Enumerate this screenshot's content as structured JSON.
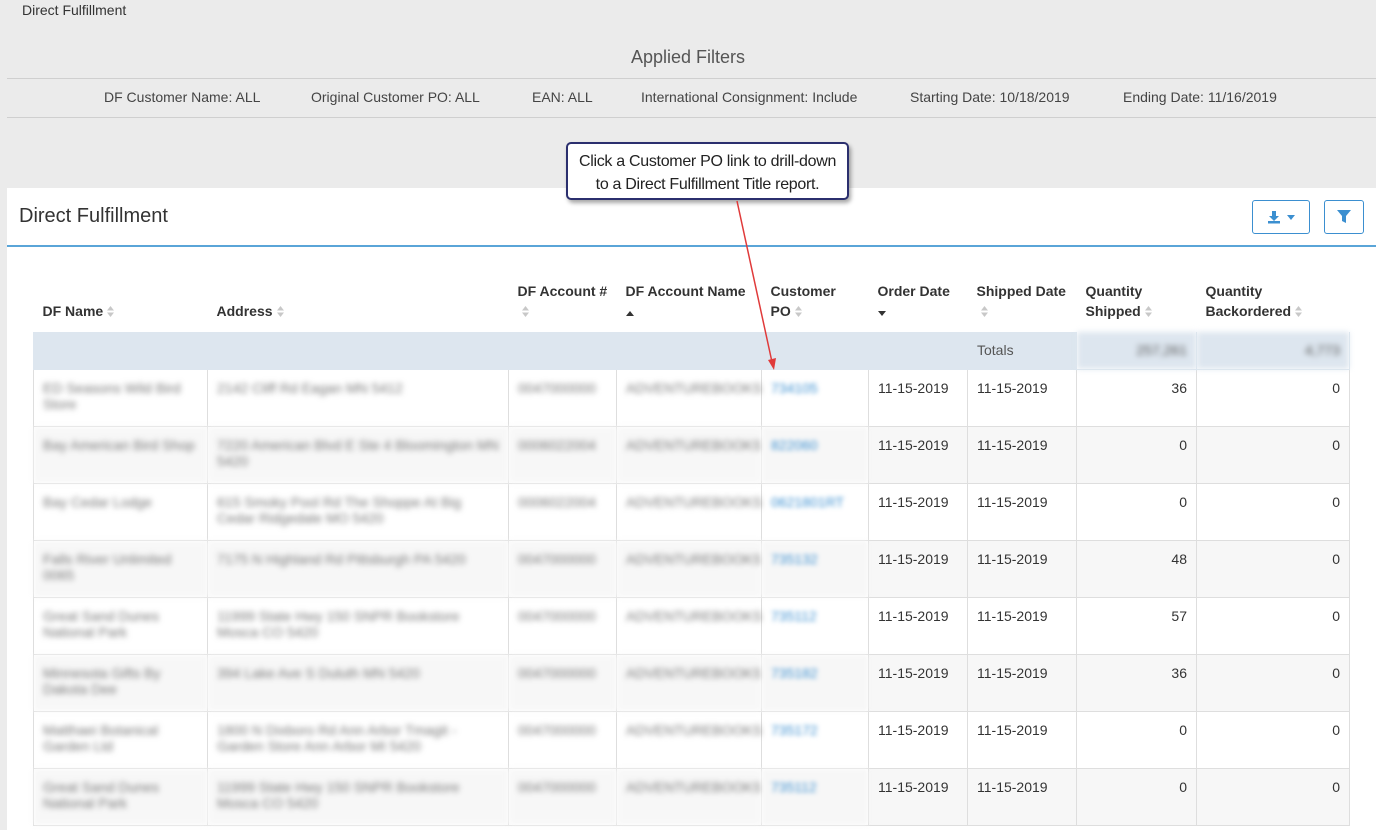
{
  "breadcrumb": "Direct Fulfillment",
  "filters": {
    "title": "Applied Filters",
    "items": [
      "DF Customer Name: ALL",
      "Original Customer PO: ALL",
      "EAN: ALL",
      "International Consignment: Include",
      "Starting Date: 10/18/2019",
      "Ending Date: 11/16/2019"
    ]
  },
  "callout": {
    "line1": "Click a Customer PO link to drill-down",
    "line2": "to a Direct Fulfillment Title report."
  },
  "panel": {
    "title": "Direct Fulfillment",
    "export_icon": "download-icon",
    "caret_icon": "caret-down-icon",
    "filter_icon": "filter-icon"
  },
  "table": {
    "columns": [
      "DF Name",
      "Address",
      "DF Account #",
      "DF Account Name",
      "Customer PO",
      "Order Date",
      "Shipped Date",
      "Quantity Shipped",
      "Quantity Backordered"
    ],
    "totals_label": "Totals",
    "totals_shipped": "257,261",
    "totals_backordered": "4,773",
    "rows": [
      {
        "name": "ED Seasons Wild Bird Store",
        "address": "2142 Cliff Rd Eagan MN 5412",
        "account": "0047000000",
        "account_name": "ADVENTUREBOOKS",
        "po": "734105",
        "order_date": "11-15-2019",
        "ship_date": "11-15-2019",
        "shipped": "36",
        "backordered": "0"
      },
      {
        "name": "Bay American Bird Shop",
        "address": "7220 American Blvd E Ste 4 Bloomington MN 5420",
        "account": "0006022004",
        "account_name": "ADVENTUREBOOKS",
        "po": "822060",
        "order_date": "11-15-2019",
        "ship_date": "11-15-2019",
        "shipped": "0",
        "backordered": "0"
      },
      {
        "name": "Bay Cedar Lodge",
        "address": "615 Smoky Pool Rd The Shoppe At Big Cedar Ridgedale MO 5420",
        "account": "0006022004",
        "account_name": "ADVENTUREBOOKS",
        "po": "0621801RT",
        "order_date": "11-15-2019",
        "ship_date": "11-15-2019",
        "shipped": "0",
        "backordered": "0"
      },
      {
        "name": "Falls River Unlimited 0065",
        "address": "7175 N Highland Rd Pittsburgh PA 5420",
        "account": "0047000000",
        "account_name": "ADVENTUREBOOKS",
        "po": "735132",
        "order_date": "11-15-2019",
        "ship_date": "11-15-2019",
        "shipped": "48",
        "backordered": "0"
      },
      {
        "name": "Great Sand Dunes National Park",
        "address": "11999 State Hwy 150 SNPR Bookstore Mosca CO 5420",
        "account": "0047000000",
        "account_name": "ADVENTUREBOOKS",
        "po": "735112",
        "order_date": "11-15-2019",
        "ship_date": "11-15-2019",
        "shipped": "57",
        "backordered": "0"
      },
      {
        "name": "Minnesota Gifts By Dakota Dee",
        "address": "394 Lake Ave S Duluth MN 5420",
        "account": "0047000000",
        "account_name": "ADVENTUREBOOKS",
        "po": "735182",
        "order_date": "11-15-2019",
        "ship_date": "11-15-2019",
        "shipped": "36",
        "backordered": "0"
      },
      {
        "name": "Matthaei Botanical Garden Ltd",
        "address": "1800 N Dixboro Rd Ann Arbor Tmagit - Garden Store Ann Arbor MI 5420",
        "account": "0047000000",
        "account_name": "ADVENTUREBOOKS",
        "po": "735172",
        "order_date": "11-15-2019",
        "ship_date": "11-15-2019",
        "shipped": "0",
        "backordered": "0"
      },
      {
        "name": "Great Sand Dunes National Park",
        "address": "11999 State Hwy 150 SNPR Bookstore Mosca CO 5420",
        "account": "0047000000",
        "account_name": "ADVENTUREBOOKS",
        "po": "735112",
        "order_date": "11-15-2019",
        "ship_date": "11-15-2019",
        "shipped": "0",
        "backordered": "0"
      }
    ]
  }
}
